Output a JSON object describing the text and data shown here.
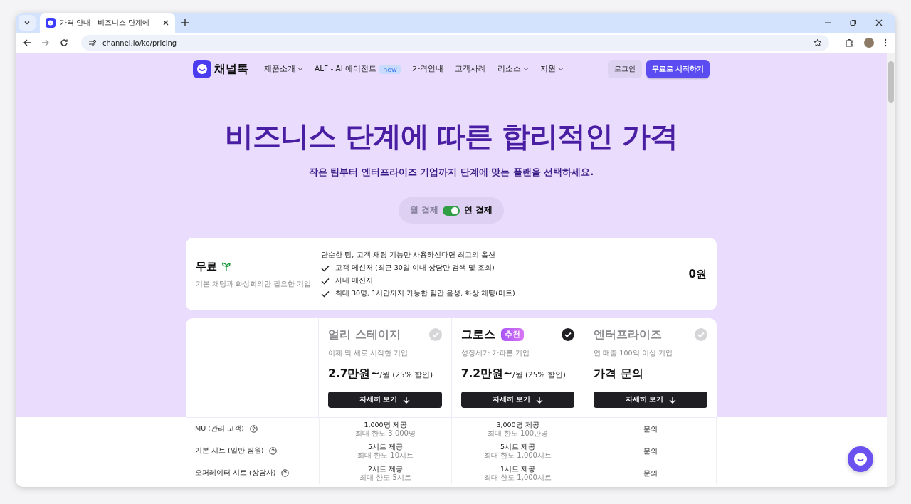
{
  "browser": {
    "tab_title": "가격 안내 - 비즈니스 단계에",
    "url": "channel.io/ko/pricing"
  },
  "nav": {
    "brand": "채널톡",
    "items": [
      {
        "label": "제품소개",
        "dropdown": true
      },
      {
        "label": "ALF - AI 에이전트",
        "dropdown": false,
        "badge": "new"
      },
      {
        "label": "가격안내",
        "dropdown": false
      },
      {
        "label": "고객사례",
        "dropdown": false
      },
      {
        "label": "리소스",
        "dropdown": true
      },
      {
        "label": "지원",
        "dropdown": true
      }
    ],
    "login": "로그인",
    "cta": "무료로 시작하기"
  },
  "hero": {
    "title": "비즈니스 단계에 따른 합리적인 가격",
    "subtitle": "작은 팀부터 엔터프라이즈 기업까지 단계에 맞는 플랜을 선택하세요."
  },
  "billing_toggle": {
    "monthly": "월 결제",
    "annual": "연 결제",
    "on": true
  },
  "free_plan": {
    "name": "무료",
    "description": "기본 채팅과 화상회의만 필요한 기업",
    "headline": "단순한 팀, 고객 채팅 기능만 사용하신다면 최고의 옵션!",
    "features": [
      "고객 메신저 (최근 30일 이내 상담만 검색 및 조회)",
      "사내 메신저",
      "최대 30명, 1시간까지 가능한 팀간 음성, 화상 채팅(미트)"
    ],
    "price": "0원"
  },
  "plans": [
    {
      "name": "얼리 스테이지",
      "selected": false,
      "description": "이제 막 새로 시작한 기업",
      "price": "2.7만원~",
      "price_suffix": "/월 (25% 할인)",
      "button": "자세히 보기"
    },
    {
      "name": "그로스",
      "badge": "추천",
      "selected": true,
      "description": "성장세가 가파른 기업",
      "price": "7.2만원~",
      "price_suffix": "/월 (25% 할인)",
      "button": "자세히 보기"
    },
    {
      "name": "엔터프라이즈",
      "selected": false,
      "description": "연 매출 100억 이상 기업",
      "price": "가격 문의",
      "button": "자세히 보기"
    }
  ],
  "features_table": [
    {
      "label": "MU (관리 고객)",
      "cells": [
        {
          "main": "1,000명 제공",
          "sub": "최대 한도 3,000명"
        },
        {
          "main": "3,000명 제공",
          "sub": "최대 한도 100만명"
        },
        {
          "main": "문의"
        }
      ]
    },
    {
      "label": "기본 시트 (일반 팀원)",
      "cells": [
        {
          "main": "5시트 제공",
          "sub": "최대 한도 10시트"
        },
        {
          "main": "5시트 제공",
          "sub": "최대 한도 1,000시트"
        },
        {
          "main": "문의"
        }
      ]
    },
    {
      "label": "오퍼레이터 시트 (상담사)",
      "cells": [
        {
          "main": "2시트 제공",
          "sub": "최대 한도 5시트"
        },
        {
          "main": "1시트 제공",
          "sub": "최대 한도 1,000시트"
        },
        {
          "main": "문의"
        }
      ]
    }
  ]
}
